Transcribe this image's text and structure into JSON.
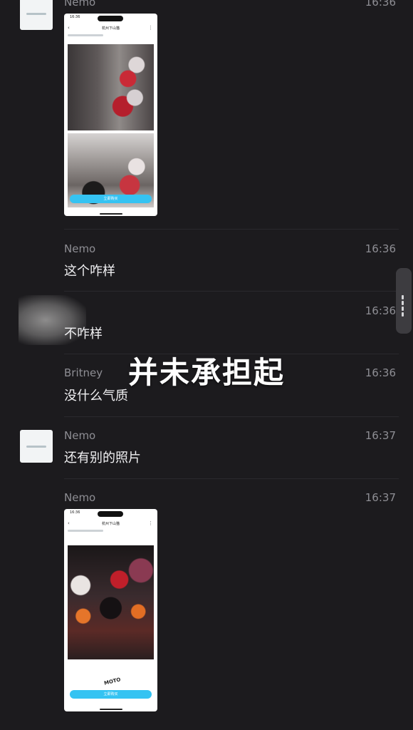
{
  "messages": [
    {
      "sender": "Nemo",
      "time": "16:36",
      "type": "image",
      "screenshot": {
        "status_time": "16:36",
        "title": "杭州下山猫",
        "button": "立即购买"
      }
    },
    {
      "sender": "Nemo",
      "time": "16:36",
      "type": "text",
      "text": "这个咋样"
    },
    {
      "sender": "",
      "time": "16:36",
      "type": "text",
      "text": "不咋样"
    },
    {
      "sender": "Britney",
      "time": "16:36",
      "type": "text",
      "text": "没什么气质"
    },
    {
      "sender": "Nemo",
      "time": "16:37",
      "type": "text",
      "text": "还有别的照片"
    },
    {
      "sender": "Nemo",
      "time": "16:37",
      "type": "image",
      "screenshot": {
        "status_time": "16:36",
        "title": "杭州下山猫",
        "button": "立即购买",
        "watermark": "MOTO"
      }
    }
  ],
  "overlay_caption": "并未承担起",
  "icons": {
    "back": "chevron-left-icon",
    "more": "more-vertical-icon",
    "scroll": "drag-handle-icon"
  },
  "colors": {
    "background": "#1c1b1e",
    "meta_text": "#8e8e94",
    "message_text": "#f0f0f2",
    "button_blue": "#35c3f2"
  }
}
